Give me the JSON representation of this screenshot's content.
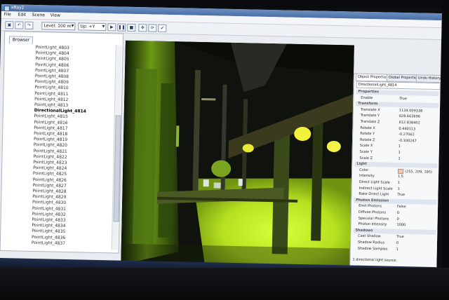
{
  "window": {
    "title": "xRay2"
  },
  "menu": [
    "File",
    "Edit",
    "Scene",
    "View"
  ],
  "toolbar": {
    "level_combo": "Level: 100 m",
    "up_combo": "Up: +Y"
  },
  "left_panel": {
    "tab": "Browser",
    "items": [
      "PointLight_4803",
      "PointLight_4804",
      "PointLight_4805",
      "PointLight_4806",
      "PointLight_4807",
      "PointLight_4808",
      "PointLight_4809",
      "PointLight_4810",
      "PointLight_4811",
      "PointLight_4812",
      "PointLight_4813",
      "DirectionalLight_4814",
      "PointLight_4815",
      "PointLight_4816",
      "PointLight_4817",
      "PointLight_4818",
      "PointLight_4819",
      "PointLight_4820",
      "PointLight_4821",
      "PointLight_4822",
      "PointLight_4823",
      "PointLight_4824",
      "PointLight_4825",
      "PointLight_4826",
      "PointLight_4827",
      "PointLight_4828",
      "PointLight_4829",
      "PointLight_4830",
      "PointLight_4831",
      "PointLight_4832",
      "PointLight_4833",
      "PointLight_4834",
      "PointLight_4835",
      "PointLight_4836",
      "PointLight_4837"
    ],
    "selected_index": 11
  },
  "right_panel": {
    "tabs": [
      "Object Properties",
      "Global Properties",
      "Undo History"
    ],
    "node_name": "DirectionalLight_4814",
    "rows": [
      {
        "section": true,
        "k": "Properties"
      },
      {
        "k": "Enable",
        "v": "True"
      },
      {
        "section": true,
        "k": "Transform"
      },
      {
        "k": "Translate X",
        "v": "1134.009338"
      },
      {
        "k": "Translate Y",
        "v": "628.663696"
      },
      {
        "k": "Translate Z",
        "v": "612.838402"
      },
      {
        "k": "Rotate X",
        "v": "0.440113"
      },
      {
        "k": "Rotate Y",
        "v": "-0.27061"
      },
      {
        "k": "Rotate Z",
        "v": "-0.100247"
      },
      {
        "k": "Scale X",
        "v": "1"
      },
      {
        "k": "Scale Y",
        "v": "1"
      },
      {
        "k": "Scale Z",
        "v": "1"
      },
      {
        "section": true,
        "k": "Light"
      },
      {
        "k": "Color",
        "v": "(255, 209, 195)",
        "swatch": "#f7c5a8"
      },
      {
        "k": "Intensity",
        "v": "1.5"
      },
      {
        "k": "Direct Light Scale",
        "v": "1"
      },
      {
        "k": "Indirect Light Scale",
        "v": "1"
      },
      {
        "k": "Bake Direct Light",
        "v": "True"
      },
      {
        "section": true,
        "k": "Photon Emission"
      },
      {
        "k": "Emit Photons",
        "v": "False"
      },
      {
        "k": "Diffuse Photons",
        "v": "0"
      },
      {
        "k": "Specular Photons",
        "v": "0"
      },
      {
        "k": "Photon Intensity",
        "v": "1000"
      },
      {
        "section": true,
        "k": "Shadows"
      },
      {
        "k": "Cast Shadow",
        "v": "True"
      },
      {
        "k": "Shadow Radius",
        "v": "0"
      },
      {
        "k": "Shadow Samples",
        "v": "1"
      }
    ],
    "status": "1 directional light source."
  }
}
